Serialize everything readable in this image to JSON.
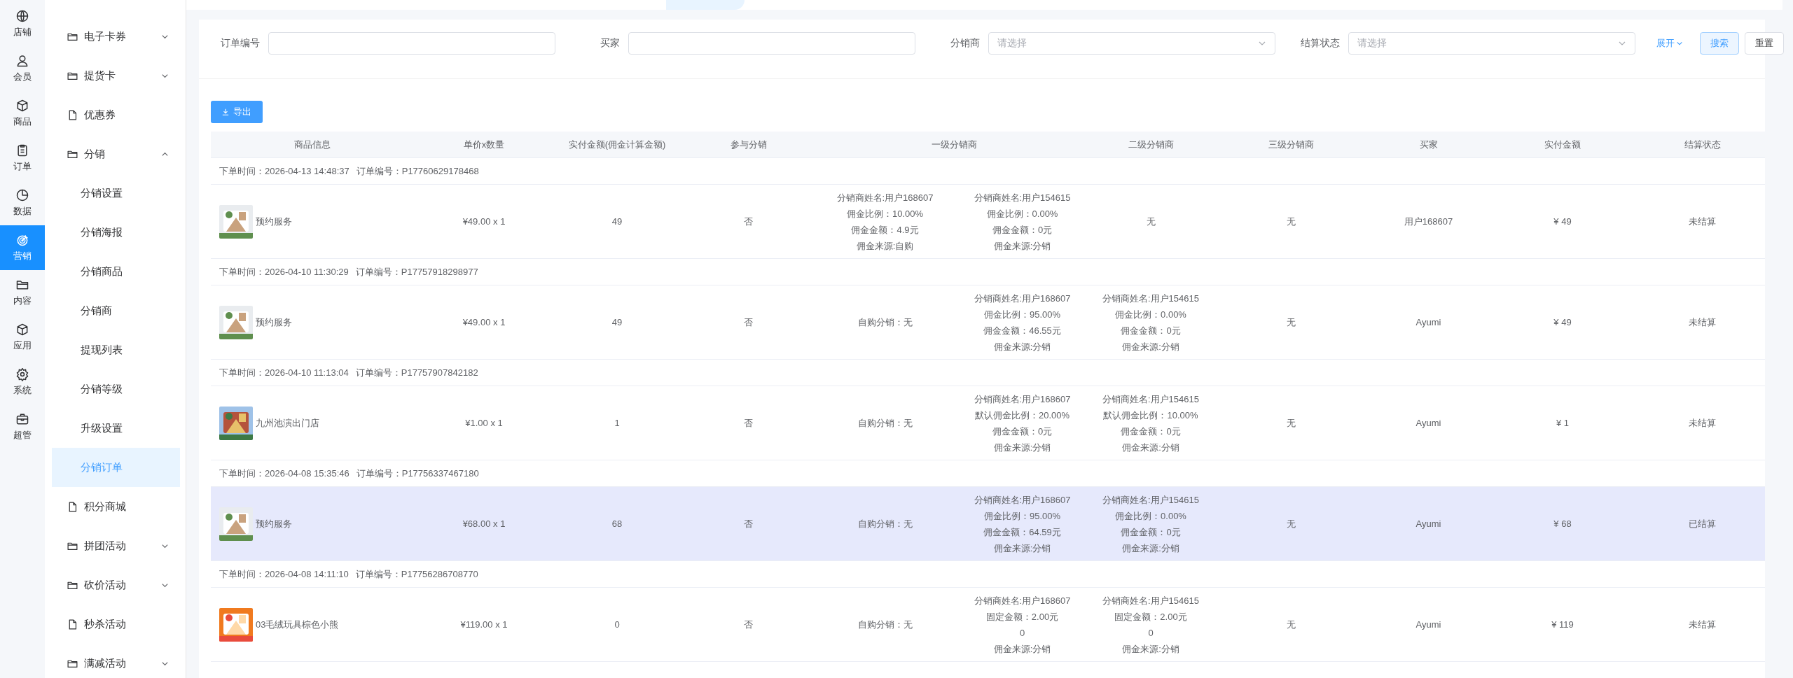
{
  "rail": [
    {
      "label": "店铺",
      "selected": false
    },
    {
      "label": "会员",
      "selected": false
    },
    {
      "label": "商品",
      "selected": false
    },
    {
      "label": "订单",
      "selected": false
    },
    {
      "label": "数据",
      "selected": false
    },
    {
      "label": "营销",
      "selected": true
    },
    {
      "label": "内容",
      "selected": false
    },
    {
      "label": "应用",
      "selected": false
    },
    {
      "label": "系统",
      "selected": false
    },
    {
      "label": "超管",
      "selected": false
    }
  ],
  "menu": [
    {
      "kind": "folder",
      "label": "电子卡券",
      "expanded": false,
      "selected": false
    },
    {
      "kind": "folder",
      "label": "提货卡",
      "expanded": false,
      "selected": false
    },
    {
      "kind": "page",
      "label": "优惠券",
      "selected": false
    },
    {
      "kind": "folder",
      "label": "分销",
      "expanded": true,
      "selected": false
    },
    {
      "kind": "sub",
      "label": "分销设置",
      "selected": false
    },
    {
      "kind": "sub",
      "label": "分销海报",
      "selected": false
    },
    {
      "kind": "sub",
      "label": "分销商品",
      "selected": false
    },
    {
      "kind": "sub",
      "label": "分销商",
      "selected": false
    },
    {
      "kind": "sub",
      "label": "提现列表",
      "selected": false
    },
    {
      "kind": "sub",
      "label": "分销等级",
      "selected": false
    },
    {
      "kind": "sub",
      "label": "升级设置",
      "selected": false
    },
    {
      "kind": "sub",
      "label": "分销订单",
      "selected": true
    },
    {
      "kind": "page",
      "label": "积分商城",
      "selected": false
    },
    {
      "kind": "folder",
      "label": "拼团活动",
      "expanded": false,
      "selected": false
    },
    {
      "kind": "folder",
      "label": "砍价活动",
      "expanded": false,
      "selected": false
    },
    {
      "kind": "page",
      "label": "秒杀活动",
      "selected": false
    },
    {
      "kind": "folder",
      "label": "满减活动",
      "expanded": false,
      "selected": false
    }
  ],
  "filters": [
    {
      "kind": "input",
      "label": "订单编号"
    },
    {
      "kind": "input",
      "label": "买家"
    },
    {
      "kind": "select",
      "label": "分销商",
      "placeholder": "请选择"
    },
    {
      "kind": "select",
      "label": "结算状态",
      "placeholder": "请选择"
    }
  ],
  "expand_link": "展开",
  "buttons": [
    {
      "kind": "primary",
      "label": "搜索"
    },
    {
      "kind": "default",
      "label": "重置"
    }
  ],
  "export_button": "导出",
  "columns": [
    "商品信息",
    "单价x数量",
    "实付金额(佣金计算金额)",
    "参与分销",
    "一级分销商",
    "二级分销商",
    "三级分销商",
    "买家",
    "实付金额",
    "结算状态"
  ],
  "orders": [
    {
      "time": "下单时间：2026-04-13 14:48:37",
      "order_no": "订单编号：P17760629178468",
      "selected": false,
      "product": "预约服务",
      "price": "¥49.00 x 1",
      "paid": "49",
      "joined": "否",
      "self_purchase": {
        "kind": "block",
        "lines": [
          "分销商姓名:用户168607",
          "佣金比例：10.00%",
          "佣金金额：4.9元",
          "佣金来源:自购"
        ]
      },
      "level1": {
        "kind": "block",
        "lines": [
          "分销商姓名:用户154615",
          "佣金比例：0.00%",
          "佣金金额：0元",
          "佣金来源:分销"
        ]
      },
      "level2": {
        "kind": "text",
        "text": "无"
      },
      "level3": "无",
      "buyer": "用户168607",
      "amount": "¥ 49",
      "status": "未结算"
    },
    {
      "time": "下单时间：2026-04-10 11:30:29",
      "order_no": "订单编号：P17757918298977",
      "selected": false,
      "product": "预约服务",
      "price": "¥49.00 x 1",
      "paid": "49",
      "joined": "否",
      "self_purchase": {
        "kind": "text",
        "text": "自购分销：无"
      },
      "level1": {
        "kind": "block",
        "lines": [
          "分销商姓名:用户168607",
          "佣金比例：95.00%",
          "佣金金额：46.55元",
          "佣金来源:分销"
        ]
      },
      "level2": {
        "kind": "block",
        "lines": [
          "分销商姓名:用户154615",
          "佣金比例：0.00%",
          "佣金金额：0元",
          "佣金来源:分销"
        ]
      },
      "level3": "无",
      "buyer": "Ayumi",
      "amount": "¥ 49",
      "status": "未结算"
    },
    {
      "time": "下单时间：2026-04-10 11:13:04",
      "order_no": "订单编号：P17757907842182",
      "selected": false,
      "product": "九州池演出门店",
      "price": "¥1.00 x 1",
      "paid": "1",
      "joined": "否",
      "self_purchase": {
        "kind": "text",
        "text": "自购分销：无"
      },
      "level1": {
        "kind": "block",
        "lines": [
          "分销商姓名:用户168607",
          "默认佣金比例：20.00%",
          "佣金金额：0元",
          "佣金来源:分销"
        ]
      },
      "level2": {
        "kind": "block",
        "lines": [
          "分销商姓名:用户154615",
          "默认佣金比例：10.00%",
          "佣金金额：0元",
          "佣金来源:分销"
        ]
      },
      "level3": "无",
      "buyer": "Ayumi",
      "amount": "¥ 1",
      "status": "未结算"
    },
    {
      "time": "下单时间：2026-04-08 15:35:46",
      "order_no": "订单编号：P17756337467180",
      "selected": true,
      "product": "预约服务",
      "price": "¥68.00 x 1",
      "paid": "68",
      "joined": "否",
      "self_purchase": {
        "kind": "text",
        "text": "自购分销：无"
      },
      "level1": {
        "kind": "block",
        "lines": [
          "分销商姓名:用户168607",
          "佣金比例：95.00%",
          "佣金金额：64.59元",
          "佣金来源:分销"
        ]
      },
      "level2": {
        "kind": "block",
        "lines": [
          "分销商姓名:用户154615",
          "佣金比例：0.00%",
          "佣金金额：0元",
          "佣金来源:分销"
        ]
      },
      "level3": "无",
      "buyer": "Ayumi",
      "amount": "¥ 68",
      "status": "已结算"
    },
    {
      "time": "下单时间：2026-04-08 14:11:10",
      "order_no": "订单编号：P17756286708770",
      "selected": false,
      "product": "03毛绒玩具棕色小熊",
      "price": "¥119.00 x 1",
      "paid": "0",
      "joined": "否",
      "self_purchase": {
        "kind": "text",
        "text": "自购分销：无"
      },
      "level1": {
        "kind": "block",
        "lines": [
          "分销商姓名:用户168607",
          "固定金额：2.00元",
          "0",
          "佣金来源:分销"
        ]
      },
      "level2": {
        "kind": "block",
        "lines": [
          "分销商姓名:用户154615",
          "固定金额：2.00元",
          "0",
          "佣金来源:分销"
        ]
      },
      "level3": "无",
      "buyer": "Ayumi",
      "amount": "¥ 119",
      "status": "未结算"
    }
  ]
}
